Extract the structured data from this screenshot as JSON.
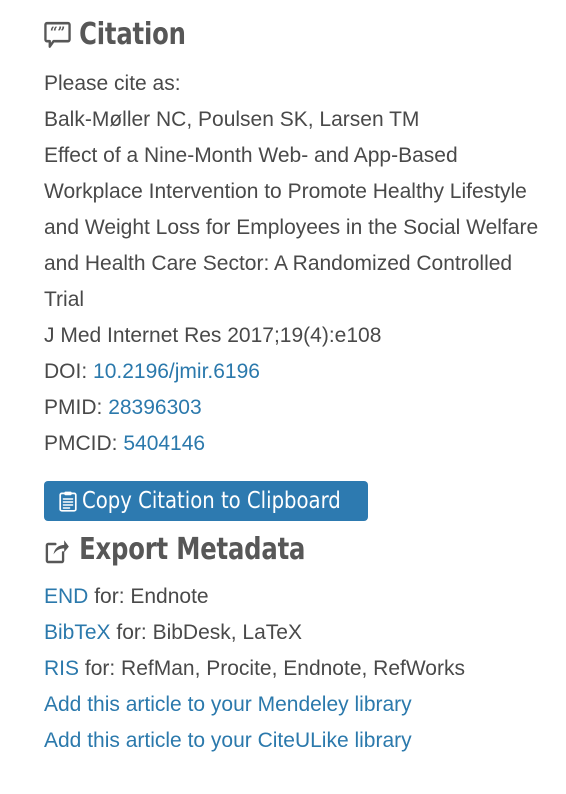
{
  "citation": {
    "heading": "Citation",
    "heading_icon": "quote-bubble-icon",
    "intro": "Please cite as:",
    "authors": "Balk-Møller NC, Poulsen SK, Larsen TM",
    "title": "Effect of a Nine-Month Web- and App-Based Workplace Intervention to Promote Healthy Lifestyle and Weight Loss for Employees in the Social Welfare and Health Care Sector: A Randomized Controlled Trial",
    "journal": "J Med Internet Res 2017;19(4):e108",
    "doi_label": "DOI:",
    "doi_value": "10.2196/jmir.6196",
    "pmid_label": "PMID:",
    "pmid_value": "28396303",
    "pmcid_label": "PMCID:",
    "pmcid_value": "5404146",
    "copy_button_label": "Copy Citation to Clipboard",
    "copy_button_icon": "clipboard-icon"
  },
  "export": {
    "heading": "Export Metadata",
    "heading_icon": "share-export-icon",
    "formats": [
      {
        "name": "END",
        "description": "for: Endnote"
      },
      {
        "name": "BibTeX",
        "description": "for: BibDesk, LaTeX"
      },
      {
        "name": "RIS",
        "description": "for: RefMan, Procite, Endnote, RefWorks"
      }
    ],
    "library_links": [
      "Add this article to your Mendeley library",
      "Add this article to your CiteULike library"
    ]
  },
  "colors": {
    "link": "#2b79ac",
    "button_background": "#2d7ab0",
    "body_text": "#494949",
    "heading_text": "#575757",
    "page_background": "#ffffff"
  }
}
